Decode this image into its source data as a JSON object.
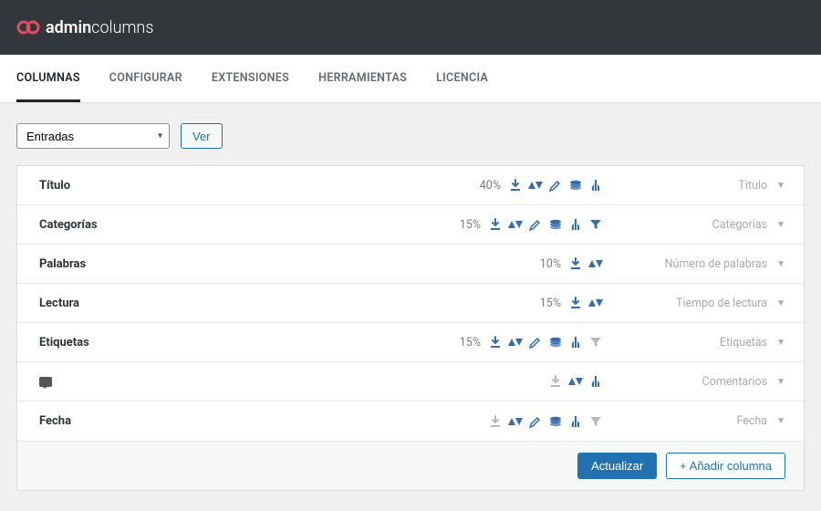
{
  "brand": {
    "prefix": "admin",
    "suffix": "columns"
  },
  "tabs": [
    {
      "label": "COLUMNAS",
      "active": true
    },
    {
      "label": "CONFIGURAR"
    },
    {
      "label": "EXTENSIONES"
    },
    {
      "label": "HERRAMIENTAS"
    },
    {
      "label": "LICENCIA"
    }
  ],
  "toolbar": {
    "select_value": "Entradas",
    "view_label": "Ver"
  },
  "icons": {
    "download": "download",
    "sort": "sort",
    "edit": "edit",
    "export": "export",
    "filter": "filter",
    "funnel": "funnel"
  },
  "columns": [
    {
      "label": "Título",
      "pct": "40%",
      "type": "Título",
      "icons": [
        "download",
        "sort",
        "edit",
        "export",
        "filter"
      ],
      "muted_dl": false
    },
    {
      "label": "Categorías",
      "pct": "15%",
      "type": "Categorías",
      "icons": [
        "download",
        "sort",
        "edit",
        "export",
        "filter",
        "funnel"
      ],
      "muted_dl": false
    },
    {
      "label": "Palabras",
      "pct": "10%",
      "type": "Número de palabras",
      "icons": [
        "download",
        "sort"
      ],
      "muted_dl": false
    },
    {
      "label": "Lectura",
      "pct": "15%",
      "type": "Tiempo de lectura",
      "icons": [
        "download",
        "sort"
      ],
      "muted_dl": false
    },
    {
      "label": "Etiquetas",
      "pct": "15%",
      "type": "Etiquetas",
      "icons": [
        "download",
        "sort",
        "edit",
        "export",
        "filter",
        "funnel"
      ],
      "muted_dl": false,
      "muted_funnel": true
    },
    {
      "label": "__comment",
      "pct": "",
      "type": "Comentarios",
      "icons": [
        "download",
        "sort",
        "filter"
      ],
      "muted_dl": true
    },
    {
      "label": "Fecha",
      "pct": "",
      "type": "Fecha",
      "icons": [
        "download",
        "sort",
        "edit",
        "export",
        "filter",
        "funnel"
      ],
      "muted_dl": true,
      "muted_funnel": true
    }
  ],
  "footer": {
    "update_label": "Actualizar",
    "add_label": "+ Añadir columna"
  },
  "colors": {
    "blue": "#356cb0",
    "muted": "#b4b9be"
  }
}
